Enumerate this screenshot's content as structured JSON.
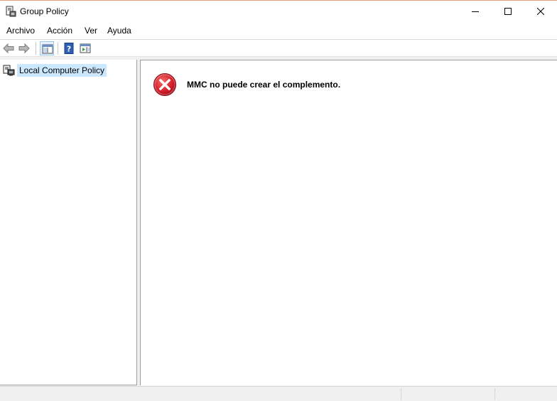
{
  "window": {
    "title": "Group Policy",
    "app_icon": "group-policy-icon",
    "controls": [
      "minimize",
      "maximize",
      "close"
    ]
  },
  "menu": {
    "items": [
      "Archivo",
      "Acción",
      "Ver",
      "Ayuda"
    ]
  },
  "toolbar": {
    "buttons": [
      "back-arrow-icon",
      "forward-arrow-icon",
      "show-hide-console-tree-icon",
      "help-icon",
      "show-action-pane-icon"
    ]
  },
  "tree": {
    "nodes": [
      {
        "label": "Local Computer Policy",
        "icon": "policy-computer-icon",
        "selected": true
      }
    ]
  },
  "result": {
    "error_icon": "error-icon",
    "message": "MMC no puede crear el complemento."
  },
  "colors": {
    "selection": "#cce8ff",
    "error_red": "#e81123",
    "title_border": "#e8a07c"
  }
}
